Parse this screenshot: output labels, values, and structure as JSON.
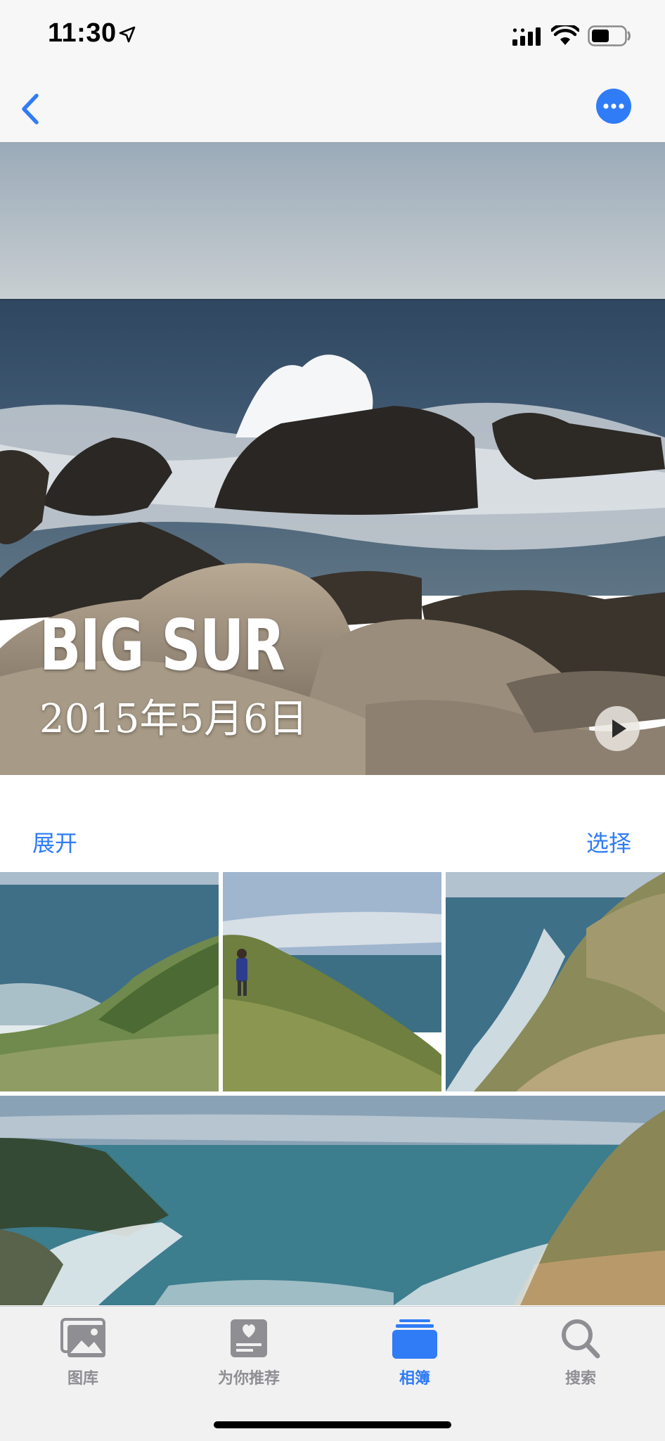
{
  "status_bar": {
    "time": "11:30",
    "icons": [
      "location-arrow-icon",
      "cellular-signal-icon",
      "wifi-icon",
      "battery-icon"
    ]
  },
  "nav": {
    "back_icon": "chevron-left-icon",
    "more_icon": "ellipsis-circle-icon",
    "accent_color": "#2f7cf6"
  },
  "hero": {
    "title": "BIG SUR",
    "date": "2015年5月6日",
    "play_icon": "play-icon"
  },
  "actions": {
    "expand_label": "展开",
    "select_label": "选择"
  },
  "photos": [
    {
      "name": "cliff-ocean-left"
    },
    {
      "name": "person-on-hill"
    },
    {
      "name": "coastline-slope"
    },
    {
      "name": "panorama-cove"
    }
  ],
  "tab_bar": {
    "tabs": [
      {
        "label": "图库",
        "icon": "photo-library-icon",
        "active": false
      },
      {
        "label": "为你推荐",
        "icon": "for-you-icon",
        "active": false
      },
      {
        "label": "相簿",
        "icon": "albums-icon",
        "active": true
      },
      {
        "label": "搜索",
        "icon": "search-icon",
        "active": false
      }
    ],
    "active_color": "#2f7cf6",
    "inactive_color": "#8e8e93"
  }
}
